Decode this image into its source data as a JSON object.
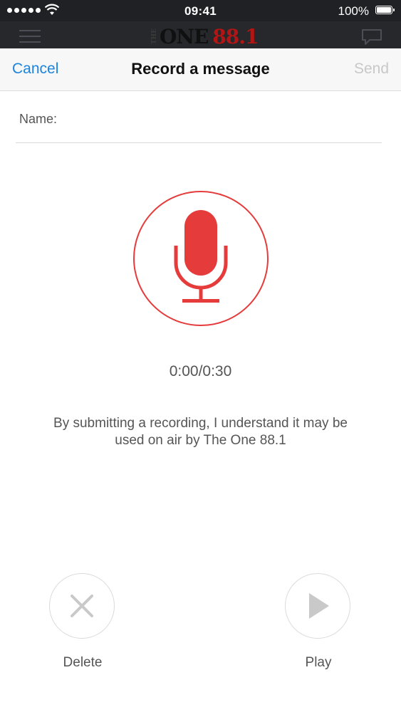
{
  "status_bar": {
    "time": "09:41",
    "battery": "100%"
  },
  "app_header": {
    "logo": {
      "small": "THE",
      "main": "ONE",
      "number": "88.1"
    }
  },
  "nav": {
    "cancel_label": "Cancel",
    "title": "Record a message",
    "send_label": "Send"
  },
  "form": {
    "name_label": "Name:",
    "name_value": "",
    "name_placeholder": ""
  },
  "recorder": {
    "timer": "0:00/0:30",
    "disclaimer": "By submitting a recording, I understand it may be used on air by The One 88.1"
  },
  "controls": {
    "delete_label": "Delete",
    "play_label": "Play"
  },
  "colors": {
    "accent_red": "#e53b3b",
    "link_blue": "#1a84e0",
    "disabled_gray": "#c8c8c8"
  }
}
